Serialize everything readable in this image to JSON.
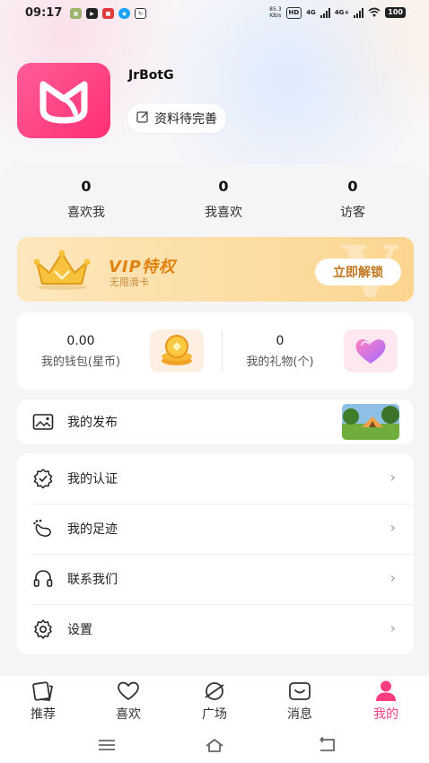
{
  "status_bar": {
    "time": "09:17",
    "net_speed_value": "85.3",
    "net_speed_unit": "KB/s",
    "hd_badge": "HD",
    "net1": "4G",
    "net2": "4G+",
    "battery": "100"
  },
  "profile": {
    "name": "JrBotG",
    "edit_label": "资料待完善"
  },
  "stats": [
    {
      "value": "0",
      "label": "喜欢我"
    },
    {
      "value": "0",
      "label": "我喜欢"
    },
    {
      "value": "0",
      "label": "访客"
    }
  ],
  "vip": {
    "title": "VIP特权",
    "subtitle": "无限滑卡",
    "button": "立即解锁"
  },
  "wallet": {
    "coins_value": "0.00",
    "coins_label": "我的钱包(星币)",
    "gifts_value": "0",
    "gifts_label": "我的礼物(个)"
  },
  "publish": {
    "label": "我的发布"
  },
  "menu": [
    {
      "label": "我的认证",
      "icon": "verified-badge-icon"
    },
    {
      "label": "我的足迹",
      "icon": "footprint-icon"
    },
    {
      "label": "联系我们",
      "icon": "headset-icon"
    },
    {
      "label": "设置",
      "icon": "gear-icon"
    }
  ],
  "tabs": [
    {
      "label": "推荐",
      "icon": "cards-icon"
    },
    {
      "label": "喜欢",
      "icon": "heart-icon"
    },
    {
      "label": "广场",
      "icon": "planet-icon"
    },
    {
      "label": "消息",
      "icon": "message-icon"
    },
    {
      "label": "我的",
      "icon": "person-icon",
      "active": true
    }
  ],
  "colors": {
    "accent": "#ff3d7f",
    "vip_text": "#e2820e",
    "vip_bg": "#fcd690"
  }
}
